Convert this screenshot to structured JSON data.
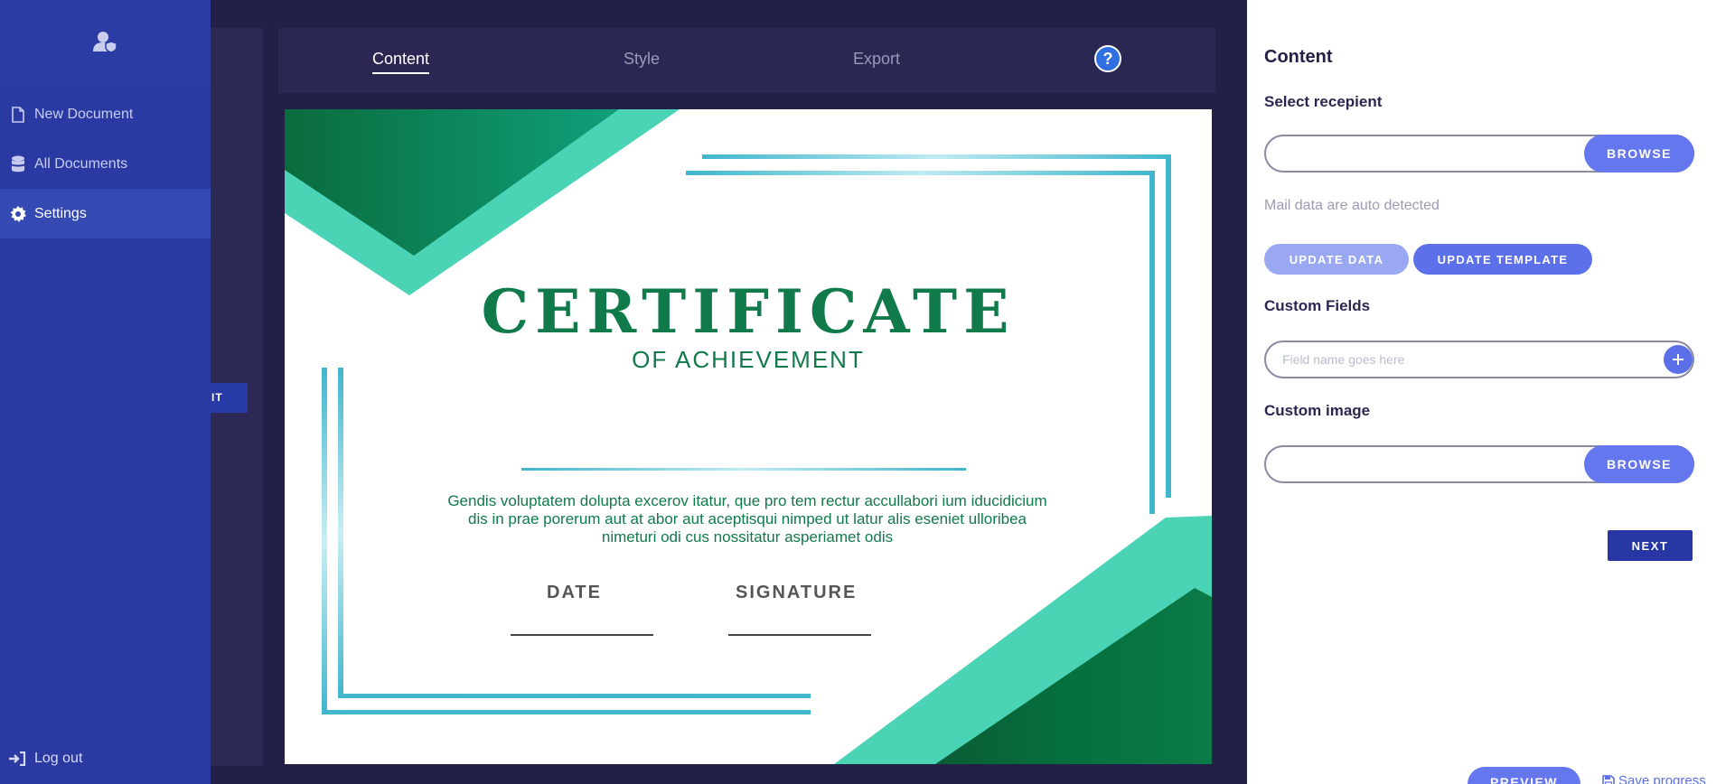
{
  "sidebar": {
    "header_icon": "user-shield-icon",
    "items": [
      {
        "label": "New Document",
        "icon": "document-icon",
        "active": false
      },
      {
        "label": "All Documents",
        "icon": "database-icon",
        "active": false
      },
      {
        "label": "Settings",
        "icon": "gear-icon",
        "active": true
      }
    ],
    "logout_label": "Log out"
  },
  "underlay": {
    "button_label": "IT"
  },
  "tabs": [
    {
      "label": "Content",
      "active": true
    },
    {
      "label": "Style",
      "active": false
    },
    {
      "label": "Export",
      "active": false
    }
  ],
  "help_label": "?",
  "certificate": {
    "title": "CERTIFICATE",
    "subtitle": "OF ACHIEVEMENT",
    "body": "Gendis voluptatem dolupta excerov itatur, que pro tem rectur accullabori ium iducidicium dis in prae porerum aut at abor aut aceptisqui nimped ut latur alis eseniet ulloribea nimeturi odi cus nossitatur asperiamet odis",
    "date_label": "DATE",
    "signature_label": "SIGNATURE"
  },
  "panel": {
    "title": "Content",
    "select_recipient_label": "Select recepient",
    "browse_label": "BROWSE",
    "hint": "Mail data are auto detected",
    "update_data_label": "UPDATE DATA",
    "update_template_label": "UPDATE TEMPLATE",
    "custom_fields_label": "Custom Fields",
    "custom_field_placeholder": "Field name goes here",
    "custom_image_label": "Custom image",
    "next_label": "NEXT",
    "preview_label": "PREVIEW",
    "save_label": "Save progress"
  },
  "colors": {
    "sidebar": "#2a3aa2",
    "accent": "#6477ee",
    "certificate_green": "#117a4a",
    "teal": "#4ad3b4"
  }
}
